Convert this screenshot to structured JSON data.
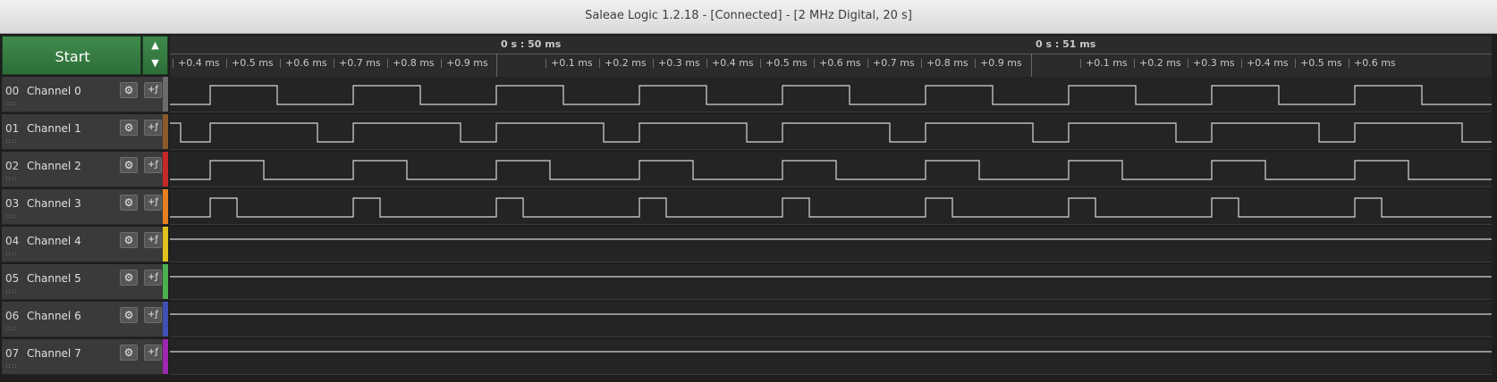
{
  "window": {
    "title": "Saleae Logic 1.2.18 - [Connected] - [2 MHz Digital, 20 s]"
  },
  "controls": {
    "start_label": "Start",
    "up_arrow": "▲",
    "down_arrow": "▼"
  },
  "ruler": {
    "major": [
      "0 s : 50 ms",
      "0 s : 51 ms"
    ],
    "minor": [
      "+0.4 ms",
      "+0.5 ms",
      "+0.6 ms",
      "+0.7 ms",
      "+0.8 ms",
      "+0.9 ms",
      "+0.1 ms",
      "+0.2 ms",
      "+0.3 ms",
      "+0.4 ms",
      "+0.5 ms",
      "+0.6 ms",
      "+0.7 ms",
      "+0.8 ms",
      "+0.9 ms",
      "+0.1 ms",
      "+0.2 ms",
      "+0.3 ms",
      "+0.4 ms",
      "+0.5 ms",
      "+0.6 ms"
    ]
  },
  "channels": [
    {
      "num": "00",
      "name": "Channel 0",
      "color": "#6b6b6b",
      "edges": [
        0.0,
        0.4,
        1.6
      ],
      "level": 0
    },
    {
      "num": "01",
      "name": "Channel 1",
      "color": "#8a5a2a",
      "edges": [
        0.0,
        0.4,
        1.2
      ],
      "level": 1
    },
    {
      "num": "02",
      "name": "Channel 2",
      "color": "#c62828",
      "edges": [
        0.0,
        0.4,
        1.0
      ],
      "level": 0
    },
    {
      "num": "03",
      "name": "Channel 3",
      "color": "#e67e22",
      "edges": [
        0.0,
        0.4,
        0.3
      ],
      "level": 0
    },
    {
      "num": "04",
      "name": "Channel 4",
      "color": "#e0c21c",
      "edges": [],
      "level": 1
    },
    {
      "num": "05",
      "name": "Channel 5",
      "color": "#4caf50",
      "edges": [],
      "level": 1
    },
    {
      "num": "06",
      "name": "Channel 6",
      "color": "#3f51b5",
      "edges": [],
      "level": 1
    },
    {
      "num": "07",
      "name": "Channel 7",
      "color": "#9c27b0",
      "edges": [],
      "level": 1
    }
  ],
  "icons": {
    "settings": "gear-icon",
    "trigger": "trigger-edge-icon"
  }
}
